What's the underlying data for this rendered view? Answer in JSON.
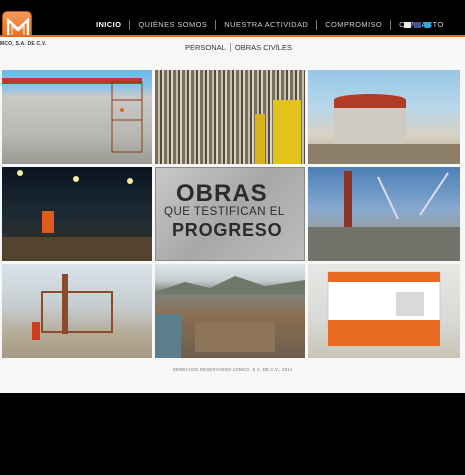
{
  "company": {
    "name": "MCO, S.A. DE C.V."
  },
  "nav": {
    "items": [
      "INICIO",
      "QUIÉNES SOMOS",
      "NUESTRA ACTIVIDAD",
      "COMPROMISO",
      "CONTACTO"
    ],
    "active": "INICIO"
  },
  "social": {
    "icons": [
      "mail-icon",
      "facebook-icon",
      "twitter-icon"
    ]
  },
  "subnav": {
    "items": [
      "PERSONAL",
      "OBRAS CIVÍLES"
    ]
  },
  "promo": {
    "line1": "OBRAS",
    "line2": "QUE TESTIFICAN EL",
    "line3": "PROGRESO"
  },
  "footer": {
    "text": "DERECHOS RESERVADOS LOMCO, S.A. DE C.V., 2014"
  },
  "colors": {
    "accent": "#e36a1f",
    "header_bg": "#000000",
    "page_bg": "#f7f7f7"
  }
}
